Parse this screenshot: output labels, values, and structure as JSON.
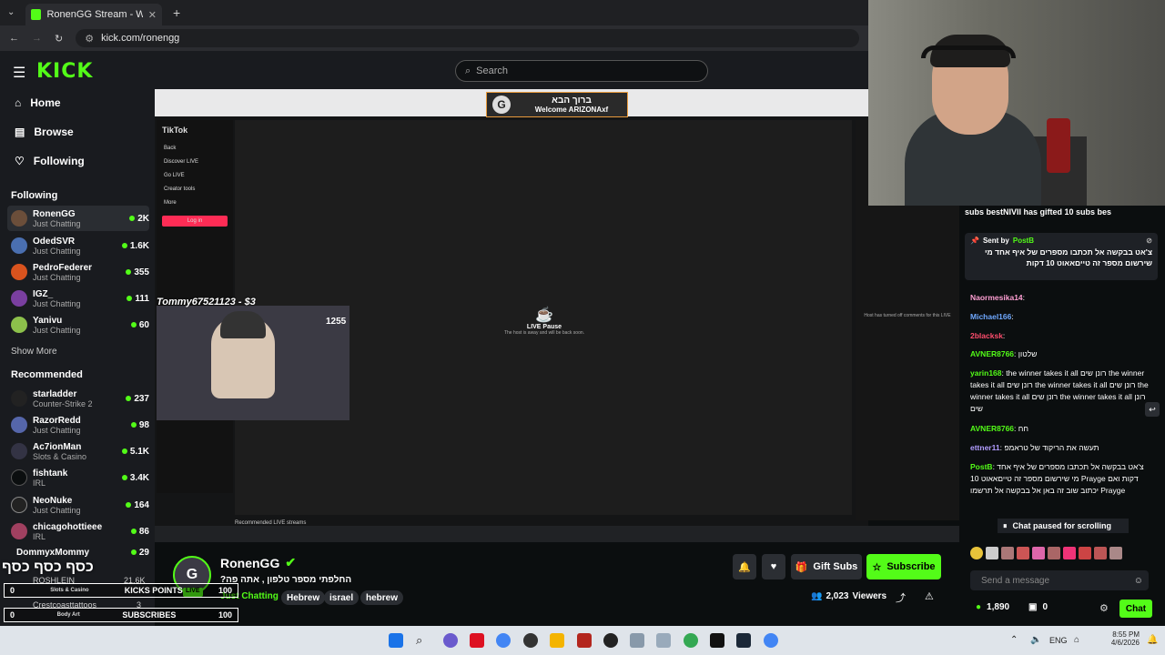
{
  "browser": {
    "tab_title": "RonenGG Stream - Watch L",
    "url": "kick.com/ronengg"
  },
  "header": {
    "logo_text": "KICK",
    "search_placeholder": "Search"
  },
  "nav": [
    {
      "label": "Home",
      "icon": "home-icon"
    },
    {
      "label": "Browse",
      "icon": "browse-icon"
    },
    {
      "label": "Following",
      "icon": "heart-icon"
    }
  ],
  "following": {
    "title": "Following",
    "channels": [
      {
        "name": "RonenGG",
        "category": "Just Chatting",
        "viewers": "2K"
      },
      {
        "name": "OdedSVR",
        "category": "Just Chatting",
        "viewers": "1.6K"
      },
      {
        "name": "PedroFederer",
        "category": "Just Chatting",
        "viewers": "355"
      },
      {
        "name": "IGZ_",
        "category": "Just Chatting",
        "viewers": "111"
      },
      {
        "name": "Yanivu",
        "category": "Just Chatting",
        "viewers": "60"
      }
    ],
    "show_more": "Show More"
  },
  "recommended": {
    "title": "Recommended",
    "channels": [
      {
        "name": "starladder",
        "category": "Counter-Strike 2",
        "viewers": "237"
      },
      {
        "name": "RazorRedd",
        "category": "Just Chatting",
        "viewers": "98"
      },
      {
        "name": "Ac7ionMan",
        "category": "Slots & Casino",
        "viewers": "5.1K"
      },
      {
        "name": "fishtank",
        "category": "IRL",
        "viewers": "3.4K"
      },
      {
        "name": "NeoNuke",
        "category": "Just Chatting",
        "viewers": "164"
      },
      {
        "name": "chicagohottieee",
        "category": "IRL",
        "viewers": "86"
      },
      {
        "name": "DommyxMommy",
        "category": "",
        "viewers": "29"
      }
    ]
  },
  "video": {
    "tiktok_label": "TikTok",
    "welcome_banner_top": "ברוך הבא",
    "welcome_banner_bottom": "Welcome ARIZONAxf",
    "donation_text": "Tommy67521123 - $3",
    "donation_number": "1255",
    "live_pause_title": "LIVE Pause",
    "live_pause_sub": "The host is away and will be back soon.",
    "comments_off": "Host has turned off comments for this LIVE",
    "tiktok_menu": [
      "Back",
      "Discover LIVE",
      "Go LIVE",
      "Creator tools",
      "More"
    ],
    "tiktok_login": "Log in",
    "recommended_label": "Recommended LIVE streams"
  },
  "stream_info": {
    "streamer": "RonenGG",
    "title": "?החלפתי מספר טלפון , אתה פה",
    "category": "Just Chatting",
    "tags": [
      "Hebrew",
      "israel",
      "hebrew"
    ],
    "viewers": "2,023",
    "viewers_label": "Viewers",
    "gift_label": "Gift Subs",
    "subscribe_label": "Subscribe",
    "live_badge": "LIVE",
    "level_badge": "100"
  },
  "overlay": {
    "hebrew_banner": "כסף כסף כסף",
    "kicks_points_label": "KICKS POINTS",
    "kicks_points_value": "100",
    "kicks_points_left": "0",
    "subscribers_label": "SUBSCRIBES",
    "subscribers_value": "100",
    "subscribers_left": "0",
    "ghost_names": [
      "ROSHLEIN",
      "Crestcoasttattoos"
    ],
    "ghost_cats": [
      "Slots & Casino",
      "Body Art"
    ],
    "ghost_views": [
      "21.6K",
      "3"
    ]
  },
  "chat": {
    "gift_ticker": "subs  bestNIVII has gifted 10 subs  bes",
    "pinned_sent_by": "Sent by",
    "pinned_user": "PostB",
    "pinned_text": "צ'אט בבקשה אל תכתבו מספרים של איף אחד מי שירשום מספר זה טייםאאוט 10 דקות",
    "messages": [
      {
        "user": "Naormesika14",
        "text": "",
        "color": "#ff9fd3"
      },
      {
        "user": "Michael166",
        "text": "",
        "color": "#6fa8ff"
      },
      {
        "user": "2blacksk",
        "text": "",
        "color": "#ff4d6d"
      },
      {
        "user": "AVNER8766",
        "text": "שלטון",
        "color": "#53fc18"
      },
      {
        "user": "yarin168",
        "text": "the winner takes it all רונן שים the winner takes it all רונן שים the winner takes it all רונן שים the winner takes it all רונן שים the winner takes it all רונן שים",
        "color": "#53fc18"
      },
      {
        "user": "AVNER8766",
        "text": "חח",
        "color": "#53fc18"
      },
      {
        "user": "ettner11",
        "text": "תעשה את הריקוד של טראמפ",
        "color": "#b19cff"
      },
      {
        "user": "PostB",
        "text": "צ'אט בבקשה אל תכתבו מספרים של איף אחד מי שירשום מספר זה טייםאאוט 10 Prayge דקות ואם יכתוב שוב זה באן אל בבקשה אל תרשמו Prayge",
        "color": "#53fc18"
      }
    ],
    "paused_label": "Chat paused for scrolling",
    "send_placeholder": "Send a message",
    "points": "1,890",
    "other_count": "0",
    "chat_button": "Chat"
  },
  "taskbar": {
    "lang": "ENG",
    "time": "8:55 PM",
    "date": "4/6/2026"
  },
  "colors": {
    "kick_green": "#53fc18",
    "bg": "#0b0e0f",
    "sidebar": "#191b1f"
  }
}
